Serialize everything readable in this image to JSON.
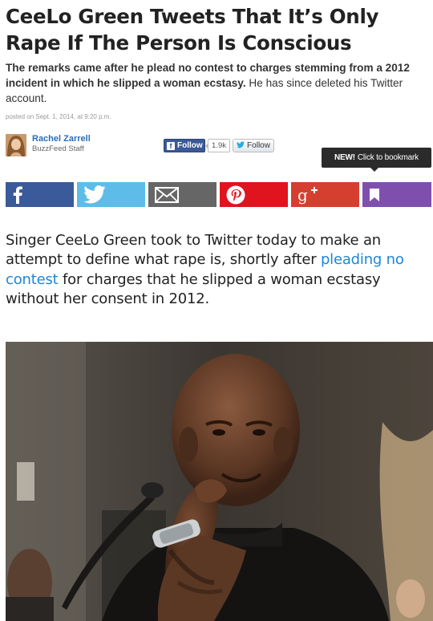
{
  "article": {
    "headline": "CeeLo Green Tweets That It’s Only Rape If The Person Is Conscious",
    "dek_bold": "The remarks came after he plead no contest to charges stemming from a 2012 incident in which he slipped a woman ecstasy.",
    "dek_rest": " He has since deleted his Twitter account.",
    "posted": "posted on Sept. 1, 2014, at 9:20 p.m."
  },
  "author": {
    "name": "Rachel Zarrell",
    "role": "BuzzFeed Staff"
  },
  "follow": {
    "facebook_label": "Follow",
    "facebook_count": "1.9k",
    "twitter_label": "Follow"
  },
  "tooltip": {
    "new_label": "NEW!",
    "text": "Click to bookmark"
  },
  "share": [
    {
      "name": "facebook",
      "color": "#3b5a99",
      "icon": "facebook-icon"
    },
    {
      "name": "twitter",
      "color": "#5dbce8",
      "icon": "twitter-bird-icon"
    },
    {
      "name": "email",
      "color": "#666666",
      "icon": "envelope-icon"
    },
    {
      "name": "pinterest",
      "color": "#e0141e",
      "icon": "pinterest-icon"
    },
    {
      "name": "google-plus",
      "color": "#d53f2f",
      "icon": "google-plus-icon"
    },
    {
      "name": "bookmark",
      "color": "#7f4fae",
      "icon": "bookmark-icon"
    }
  ],
  "lede": {
    "before": "Singer CeeLo Green took to Twitter today to make an attempt to define what rape is, shortly after ",
    "link": "pleading no contest",
    "after": " for charges that he slipped a woman ecstasy without her consent in 2012."
  },
  "colors": {
    "link": "#1e86d9",
    "author": "#2a6db8"
  }
}
